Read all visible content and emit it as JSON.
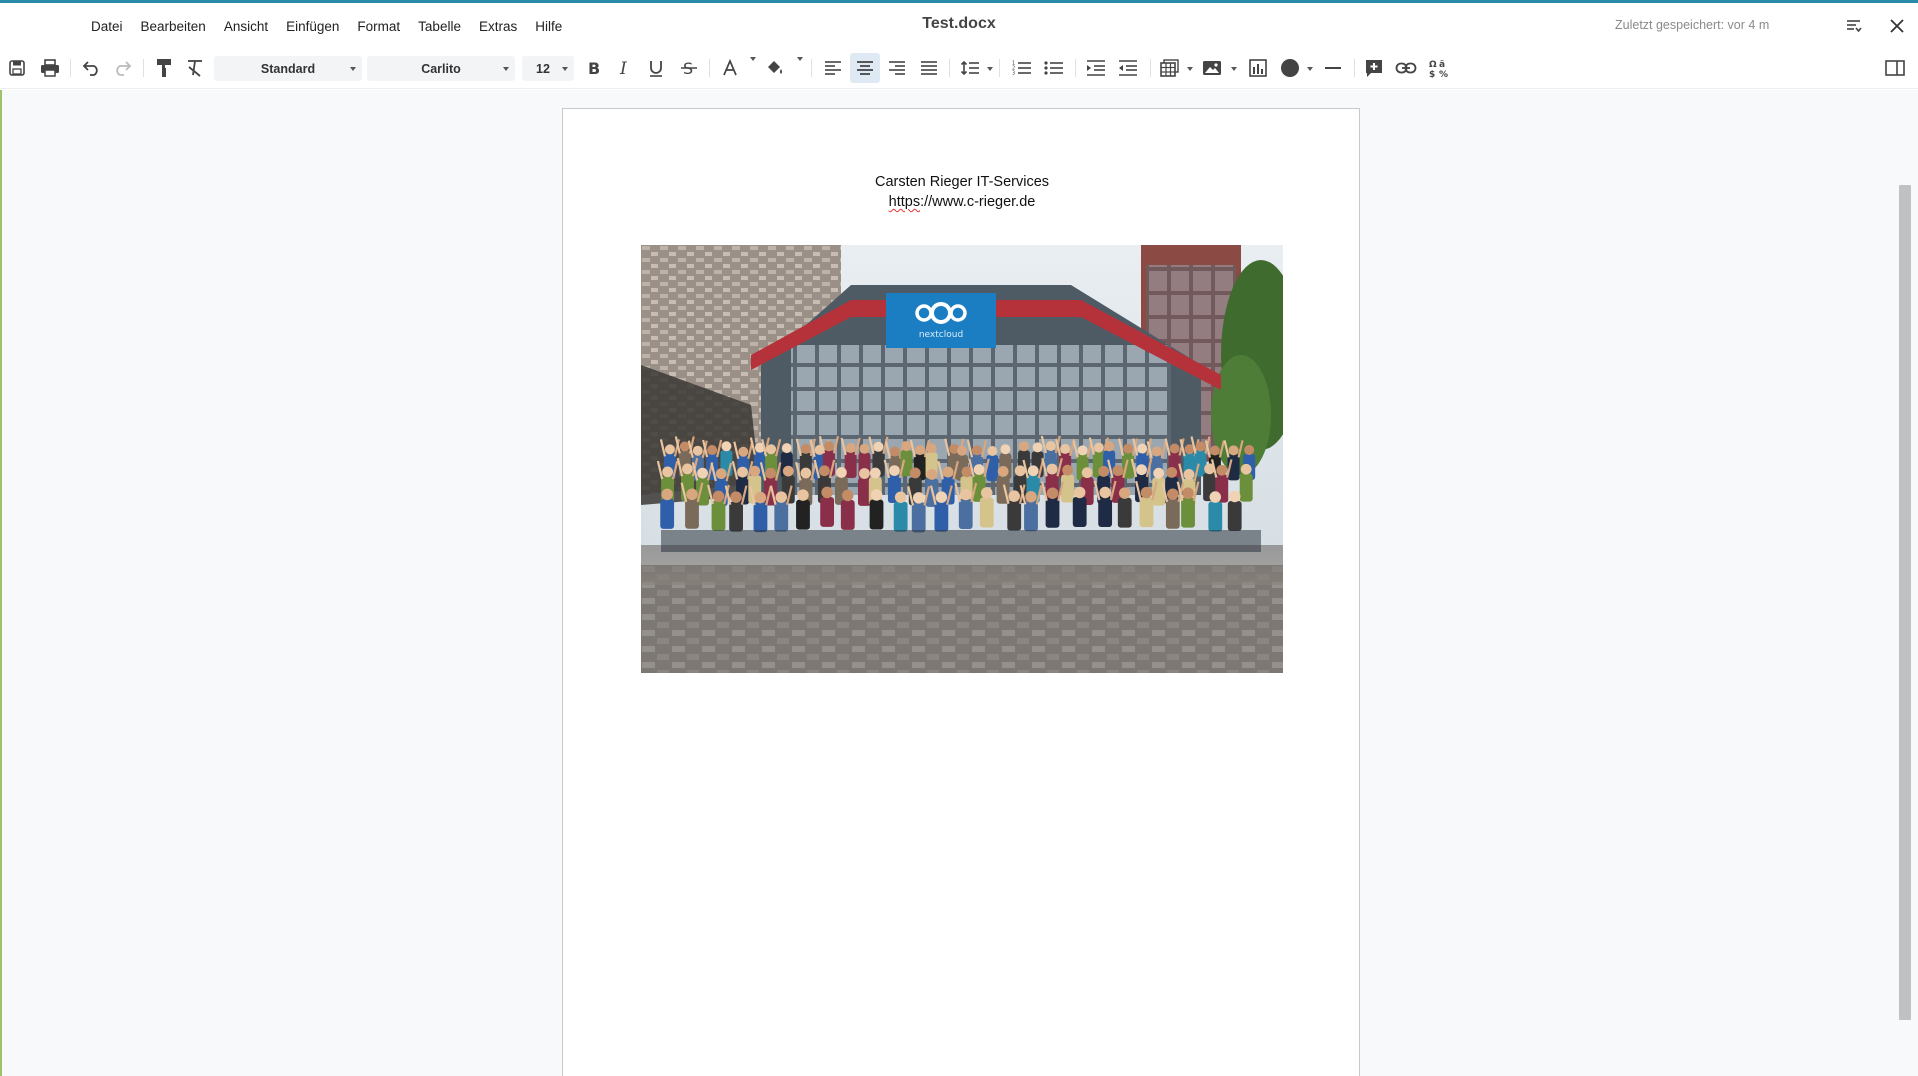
{
  "app": {
    "document_title": "Test.docx",
    "saved_status": "Zuletzt gespeichert: vor 4 m"
  },
  "menu": {
    "items": [
      {
        "label": "Datei"
      },
      {
        "label": "Bearbeiten"
      },
      {
        "label": "Ansicht"
      },
      {
        "label": "Einfügen"
      },
      {
        "label": "Format"
      },
      {
        "label": "Tabelle"
      },
      {
        "label": "Extras"
      },
      {
        "label": "Hilfe"
      }
    ]
  },
  "toolbar": {
    "paragraph_style": "Standard",
    "font_name": "Carlito",
    "font_size": "12",
    "active_alignment": "center",
    "icons": [
      "save-icon",
      "print-icon",
      "undo-icon",
      "redo-icon",
      "clone-formatting-icon",
      "clear-formatting-icon",
      "bold-icon",
      "italic-icon",
      "underline-icon",
      "strikethrough-icon",
      "font-color-icon",
      "highlight-icon",
      "align-left-icon",
      "align-center-icon",
      "align-right-icon",
      "justify-icon",
      "line-spacing-icon",
      "numbered-list-icon",
      "bullet-list-icon",
      "indent-icon",
      "outdent-icon",
      "table-icon",
      "image-icon",
      "chart-icon",
      "shape-icon",
      "horizontal-line-icon",
      "comment-icon",
      "hyperlink-icon",
      "special-character-icon",
      "sidebar-icon"
    ]
  },
  "document": {
    "header_line": "Carsten Rieger IT-Services",
    "url_misspelled_part": "https",
    "url_rest": "://www.c-rieger.de",
    "image_banner_text": "nextcloud"
  },
  "colors": {
    "accent": "#2a8aa8",
    "doc_border_left": "#9cc36b",
    "banner_blue": "#1b7ec2",
    "selected_button": "#dfe9f3"
  }
}
